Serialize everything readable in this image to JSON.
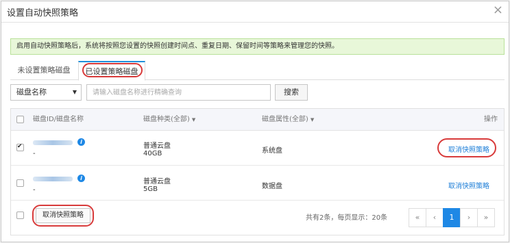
{
  "dialog": {
    "title": "设置自动快照策略",
    "close_icon": "×"
  },
  "notice": {
    "text": "启用自动快照策略后，系统将按照您设置的快照创建时间点、重复日期、保留时间等策略来管理您的快照。"
  },
  "tabs": [
    {
      "label": "未设置策略磁盘",
      "active": false
    },
    {
      "label": "已设置策略磁盘",
      "active": true
    }
  ],
  "filter": {
    "select_value": "磁盘名称",
    "caret": "▼",
    "search_placeholder": "请输入磁盘名称进行精确查询",
    "search_button": "搜索"
  },
  "table": {
    "headers": {
      "id_name": "磁盘ID/磁盘名称",
      "type": "磁盘种类(全部)",
      "attr": "磁盘属性(全部)",
      "actions": "操作"
    },
    "rows": [
      {
        "checked": true,
        "name_dash": "-",
        "type": "普通云盘",
        "size": "40GB",
        "attr": "系统盘",
        "action": "取消快照策略"
      },
      {
        "checked": false,
        "name_dash": "-",
        "type": "普通云盘",
        "size": "5GB",
        "attr": "数据盘",
        "action": "取消快照策略"
      }
    ]
  },
  "footer": {
    "bulk_button": "取消快照策略",
    "pager_info": "共有2条，每页显示：20条",
    "pager": [
      "«",
      "‹",
      "1",
      "›",
      "»"
    ],
    "current_page": "1"
  },
  "colors": {
    "accent": "#1e88e5",
    "annotation": "#d83a3a",
    "notice_bg": "#e8f7d9"
  }
}
